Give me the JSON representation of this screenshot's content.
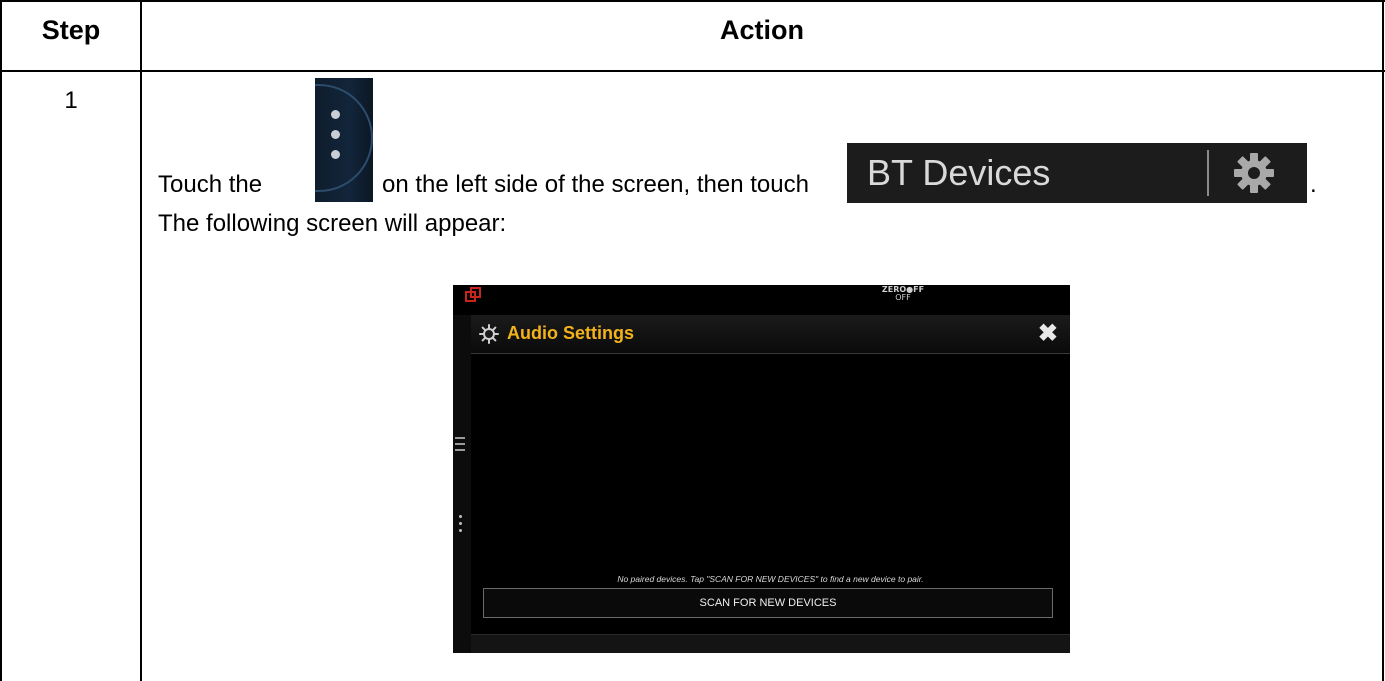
{
  "table": {
    "headers": {
      "step": "Step",
      "action": "Action"
    },
    "rows": [
      {
        "step": "1",
        "text_before_icon": "Touch the",
        "text_after_icon": "on the left side of the screen, then touch",
        "text_end": ".",
        "second_line": "The following screen will appear:",
        "menu_icon": "vertical-dots-menu-icon",
        "bt_button": {
          "label": "BT Devices",
          "icon": "gear-icon"
        }
      }
    ]
  },
  "device_screen": {
    "zero_off_title": "ZERO●FF",
    "zero_off_sub": "OFF",
    "dialog_title": "Audio Settings",
    "close_glyph": "✖",
    "no_paired_text": "No paired devices. Tap \"SCAN FOR NEW DEVICES\" to find a new device to pair.",
    "scan_button_label": "SCAN FOR NEW DEVICES",
    "accent_color": "#f2b21c",
    "logo_color": "#c8261c"
  }
}
